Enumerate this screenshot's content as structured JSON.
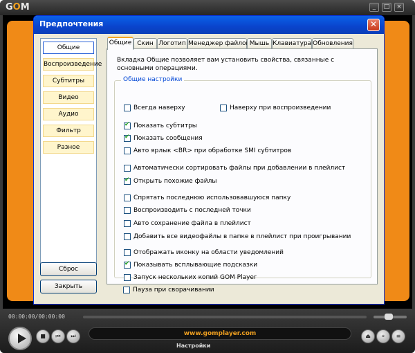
{
  "player": {
    "logo_text": "GOM",
    "window_buttons": [
      "_",
      "□",
      "×"
    ],
    "timecode": "00:00:00/00:00:00",
    "url": "www.gomplayer.com",
    "settings_link": "Настройки",
    "controls": [
      "■",
      "⏮",
      "⏭",
      "⏏",
      "⌖",
      "≡"
    ],
    "accent_color": "#f08a17"
  },
  "dialog": {
    "title": "Предпочтения",
    "close_glyph": "✕",
    "categories": [
      {
        "label": "Общие",
        "selected": true
      },
      {
        "label": "Воспроизведение",
        "selected": false
      },
      {
        "label": "Субтитры",
        "selected": false
      },
      {
        "label": "Видео",
        "selected": false
      },
      {
        "label": "Аудио",
        "selected": false
      },
      {
        "label": "Фильтр",
        "selected": false
      },
      {
        "label": "Разное",
        "selected": false
      }
    ],
    "reset_label": "Сброс",
    "close_label": "Закрыть",
    "tabs": [
      {
        "label": "Общие",
        "selected": true
      },
      {
        "label": "Скин",
        "selected": false
      },
      {
        "label": "Логотип",
        "selected": false
      },
      {
        "label": "Менеджер файлов",
        "selected": false
      },
      {
        "label": "Мышь",
        "selected": false
      },
      {
        "label": "Клавиатура",
        "selected": false
      },
      {
        "label": "Обновления",
        "selected": false
      }
    ],
    "description": "Вкладка Общие позволяет вам установить свойства, связанные с основными операциями.",
    "group_title": "Общие настройки",
    "options": [
      {
        "label": "Всегда наверху",
        "checked": false
      },
      {
        "label": "Наверху при воспроизведении",
        "checked": false
      },
      {
        "label": "Показать субтитры",
        "checked": true
      },
      {
        "label": "Показать сообщения",
        "checked": true
      },
      {
        "label": "Авто ярлык <BR> при обработке SMI субтитров",
        "checked": false
      },
      {
        "label": "Автоматически сортировать файлы при добавлении в плейлист",
        "checked": false
      },
      {
        "label": "Открыть похожие файлы",
        "checked": true
      },
      {
        "label": "Спрятать последнюю использовавшуюся папку",
        "checked": false
      },
      {
        "label": "Воспроизводить с последней точки",
        "checked": false
      },
      {
        "label": "Авто сохранение файла в плейлист",
        "checked": false
      },
      {
        "label": "Добавить все видеофайлы в папке в плейлист при проигрывании",
        "checked": false
      },
      {
        "label": "Отображать иконку на области уведомлений",
        "checked": false
      },
      {
        "label": "Показывать всплывающие подсказки",
        "checked": true
      },
      {
        "label": "Запуск нескольких копий GOM Player",
        "checked": false
      },
      {
        "label": "Пауза при сворачивании",
        "checked": false
      }
    ]
  }
}
